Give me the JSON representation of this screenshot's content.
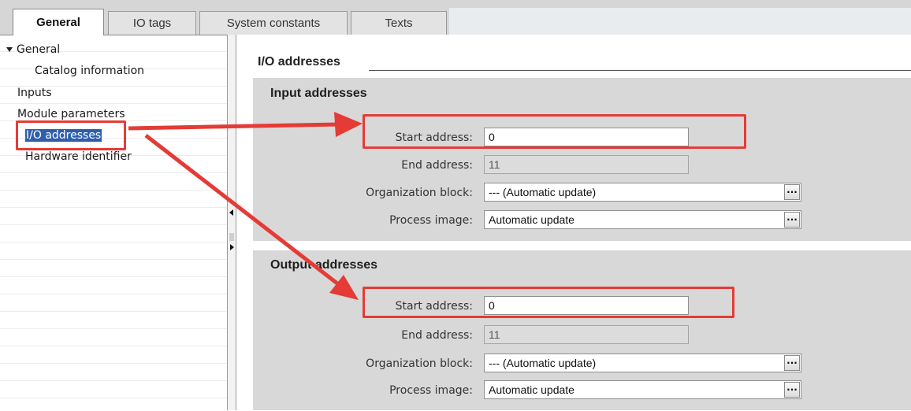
{
  "tabs": [
    {
      "label": "General",
      "active": true
    },
    {
      "label": "IO tags",
      "active": false
    },
    {
      "label": "System constants",
      "active": false
    },
    {
      "label": "Texts",
      "active": false
    }
  ],
  "tree": {
    "items": [
      {
        "label": "General",
        "expanded": true
      },
      {
        "label": "Catalog information"
      },
      {
        "label": "Inputs"
      },
      {
        "label": "Module parameters"
      },
      {
        "label": "I/O addresses",
        "selected": true
      },
      {
        "label": "Hardware identifier"
      }
    ]
  },
  "main": {
    "title": "I/O addresses",
    "input_group": {
      "title": "Input addresses",
      "start_label": "Start address:",
      "start_value": "0",
      "end_label": "End address:",
      "end_value": "11",
      "ob_label": "Organization block:",
      "ob_value": "--- (Automatic update)",
      "pi_label": "Process image:",
      "pi_value": "Automatic update"
    },
    "output_group": {
      "title": "Output addresses",
      "start_label": "Start address:",
      "start_value": "0",
      "end_label": "End address:",
      "end_value": "11",
      "ob_label": "Organization block:",
      "ob_value": "--- (Automatic update)",
      "pi_label": "Process image:",
      "pi_value": "Automatic update"
    }
  },
  "browse_label": "...",
  "colors": {
    "annotation": "#e53b36",
    "selection": "#2f5faa",
    "group_bg": "#d8d8d8"
  }
}
